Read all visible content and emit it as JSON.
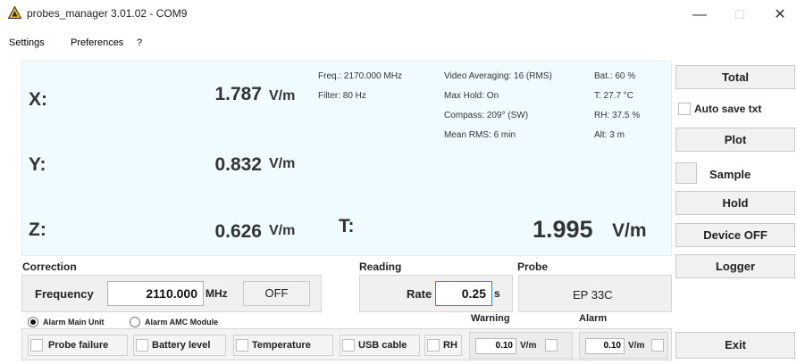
{
  "window": {
    "title": "probes_manager 3.01.02 - COM9",
    "minimize_glyph": "—",
    "maximize_glyph": "□",
    "close_glyph": "✕",
    "app_icon": "warning-triangle-icon"
  },
  "menu": {
    "settings": "Settings",
    "preferences": "Preferences",
    "help": "?"
  },
  "display": {
    "x_label": "X:",
    "x_value": "1.787",
    "x_unit": "V/m",
    "y_label": "Y:",
    "y_value": "0.832",
    "y_unit": "V/m",
    "z_label": "Z:",
    "z_value": "0.626",
    "z_unit": "V/m",
    "t_label": "T:",
    "t_value": "1.995",
    "t_unit": "V/m",
    "freq": "Freq.: 2170.000 MHz",
    "filter": "Filter: 80 Hz",
    "video_avg": "Video Averaging: 16 (RMS)",
    "max_hold": "Max Hold: On",
    "compass": "Compass: 209° (SW)",
    "mean_rms": "Mean RMS: 6 min",
    "battery": "Bat.:  60 %",
    "temperature": "T: 27.7 °C",
    "humidity": "RH: 37.5 %",
    "altitude": "Alt: 3 m"
  },
  "side_buttons": {
    "total": "Total",
    "auto_save": "Auto save txt",
    "plot": "Plot",
    "sample": "Sample",
    "hold": "Hold",
    "device_off": "Device OFF",
    "logger": "Logger",
    "exit": "Exit"
  },
  "correction": {
    "section": "Correction",
    "frequency_label": "Frequency",
    "frequency_value": "2110.000",
    "frequency_unit": "MHz",
    "toggle": "OFF"
  },
  "reading": {
    "section": "Reading",
    "rate_label": "Rate",
    "rate_value": "0.25",
    "rate_unit": "s"
  },
  "probe": {
    "section": "Probe",
    "model": "EP 33C"
  },
  "alarm": {
    "main_unit": "Alarm Main Unit",
    "amc_module": "Alarm AMC Module",
    "probe_failure": "Probe failure",
    "battery_level": "Battery level",
    "temperature": "Temperature",
    "usb_cable": "USB cable",
    "rh": "RH",
    "warning_label": "Warning",
    "warning_value": "0.10",
    "warning_unit": "V/m",
    "alarm_label": "Alarm",
    "alarm_value": "0.10",
    "alarm_unit": "V/m"
  },
  "colors": {
    "display_bg": "#f0fbff",
    "accent_border": "#3c7fd6",
    "icon_yellow": "#f2c200"
  }
}
